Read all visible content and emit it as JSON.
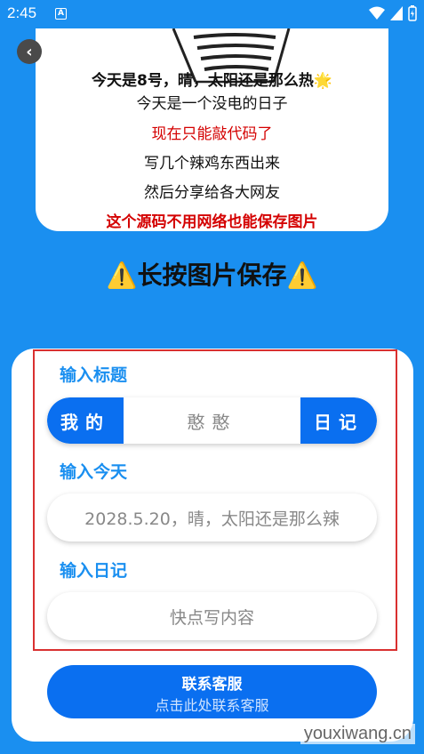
{
  "status": {
    "time": "2:45",
    "notif_letter": "A"
  },
  "preview": {
    "line1": "今天是8号，晴，太阳还是那么热🌟",
    "line2": "今天是一个没电的日子",
    "line3": "现在只能敲代码了",
    "line4": "写几个辣鸡东西出来",
    "line5": "然后分享给各大网友",
    "line6": "这个源码不用网络也能保存图片"
  },
  "save_hint": "⚠️长按图片保存⚠️",
  "form": {
    "title_label": "输入标题",
    "title_left": "我的",
    "title_value": "憨憨",
    "title_right": "日记",
    "today_label": "输入今天",
    "today_placeholder": "2028.5.20，晴，太阳还是那么辣",
    "diary_label": "输入日记",
    "diary_placeholder": "快点写内容"
  },
  "contact": {
    "title": "联系客服",
    "subtitle": "点击此处联系客服"
  },
  "watermark": "youxiwang.cn",
  "colors": {
    "background": "#1a8ff0",
    "accent": "#0a6ff0",
    "error_frame": "#d93030"
  }
}
